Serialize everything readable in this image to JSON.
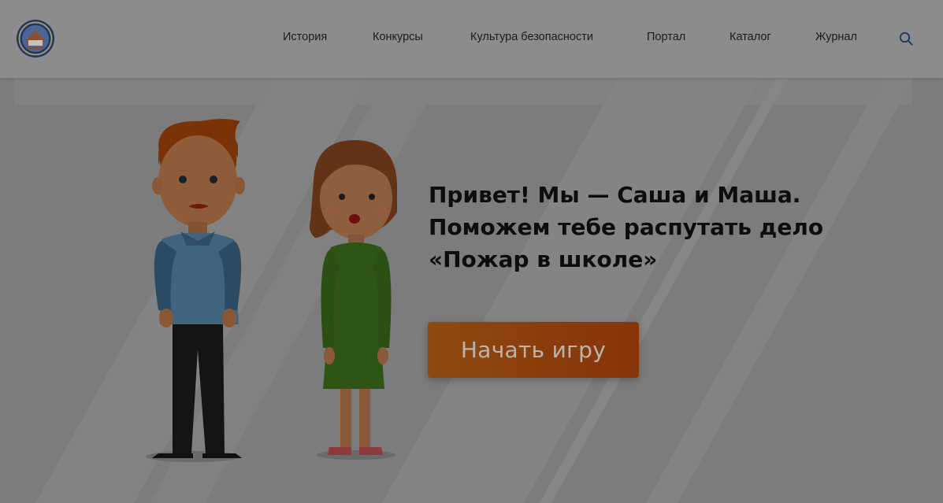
{
  "header": {
    "logo_alt": "logo",
    "nav": [
      {
        "label": "История"
      },
      {
        "label": "Конкурсы"
      },
      {
        "label": "Культура безопасности"
      },
      {
        "label": "Портал"
      },
      {
        "label": "Каталог"
      },
      {
        "label": "Журнал"
      }
    ],
    "search_icon": "search-icon"
  },
  "hero": {
    "heading_lines": [
      "Привет! Мы — Саша и Маша.",
      "Поможем тебе распутать дело",
      "«Пожар в школе»"
    ],
    "start_button": "Начать игру"
  },
  "colors": {
    "overlay_gray": "#7a7a7a",
    "header_bg": "#8c8c8c",
    "button_orange": "#8a3c0c",
    "button_text": "#b9b4ae",
    "search_icon": "#1d3a66"
  }
}
